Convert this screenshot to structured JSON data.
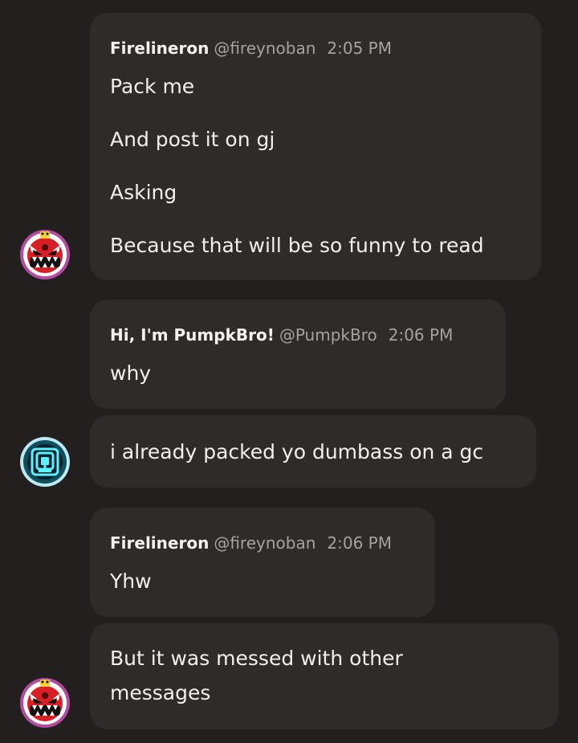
{
  "messages": [
    {
      "author": "Firelineron",
      "handle": "@fireynoban",
      "time": "2:05 PM",
      "lines": [
        "Pack me",
        "And post it on gj",
        "Asking",
        "Because that will be so funny to read"
      ]
    },
    {
      "author": "Hi, I'm PumpkBro!",
      "handle": "@PumpkBro",
      "time": "2:06 PM",
      "lines": [
        "why"
      ]
    },
    {
      "lines": [
        "i already packed yo dumbass on a gc"
      ]
    },
    {
      "author": "Firelineron",
      "handle": "@fireynoban",
      "time": "2:06 PM",
      "lines": [
        "Yhw"
      ]
    },
    {
      "lines": [
        "But it was messed with other",
        "messages"
      ]
    }
  ],
  "avatars": {
    "firelineron": "demon-face-avatar",
    "pumpkbro": "cyan-square-badge-avatar"
  },
  "colors": {
    "background": "#221f1e",
    "bubble": "#2f2b29",
    "text": "#f2efed",
    "meta": "#a8a29f"
  }
}
